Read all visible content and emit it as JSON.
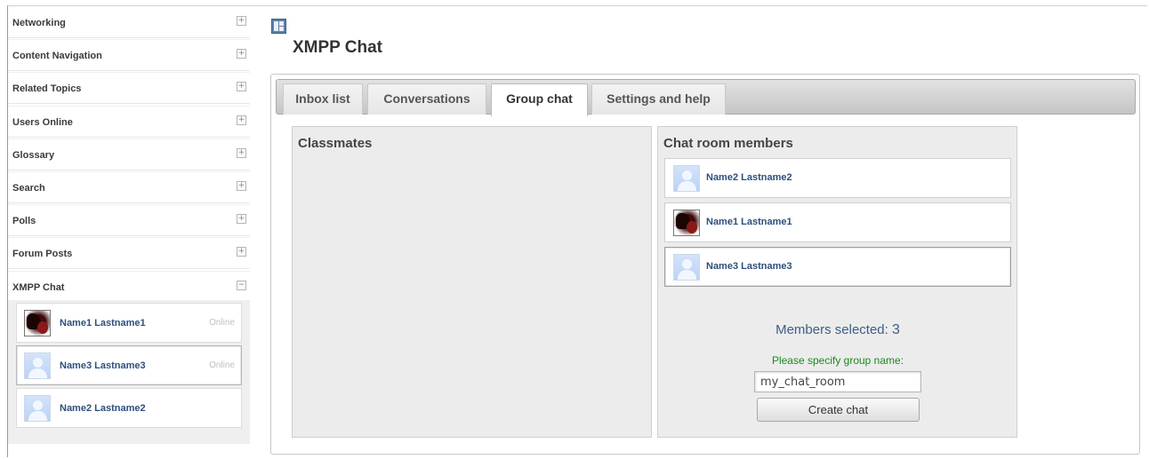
{
  "sidebar": {
    "blocks": [
      {
        "title": "Networking",
        "toggle": "+"
      },
      {
        "title": "Content Navigation",
        "toggle": "+"
      },
      {
        "title": "Related Topics",
        "toggle": "+"
      },
      {
        "title": "Users Online",
        "toggle": "+"
      },
      {
        "title": "Glossary",
        "toggle": "+"
      },
      {
        "title": "Search",
        "toggle": "+"
      },
      {
        "title": "Polls",
        "toggle": "+"
      },
      {
        "title": "Forum Posts",
        "toggle": "+"
      },
      {
        "title": "XMPP Chat",
        "toggle": "−"
      }
    ],
    "chat_contacts": [
      {
        "name": "Name1 Lastname1",
        "status": "Online",
        "avatar": "photo-avatar"
      },
      {
        "name": "Name3 Lastname3",
        "status": "Online",
        "avatar": "default-user-avatar"
      },
      {
        "name": "Name2 Lastname2",
        "status": "",
        "avatar": "default-user-avatar"
      }
    ]
  },
  "main": {
    "layout_icon": "layout-toggle-icon",
    "title": "XMPP Chat",
    "tabs": [
      {
        "label": "Inbox list",
        "active": false
      },
      {
        "label": "Conversations",
        "active": false
      },
      {
        "label": "Group chat",
        "active": true
      },
      {
        "label": "Settings and help",
        "active": false
      }
    ],
    "classmates": {
      "title": "Classmates"
    },
    "chat_room": {
      "title": "Chat room members",
      "members": [
        {
          "name": "Name2 Lastname2",
          "avatar": "default-user-avatar"
        },
        {
          "name": "Name1 Lastname1",
          "avatar": "photo-avatar"
        },
        {
          "name": "Name3 Lastname3",
          "avatar": "default-user-avatar"
        }
      ],
      "members_selected_label": "Members selected:",
      "members_selected_count": "3",
      "group_name_label": "Please specify group name:",
      "group_name_value": "my_chat_room",
      "create_button": "Create chat"
    }
  },
  "colors": {
    "link_blue": "#2d4f7c",
    "green_label": "#1d8a1d",
    "tab_bar": "#c5c5c5"
  }
}
